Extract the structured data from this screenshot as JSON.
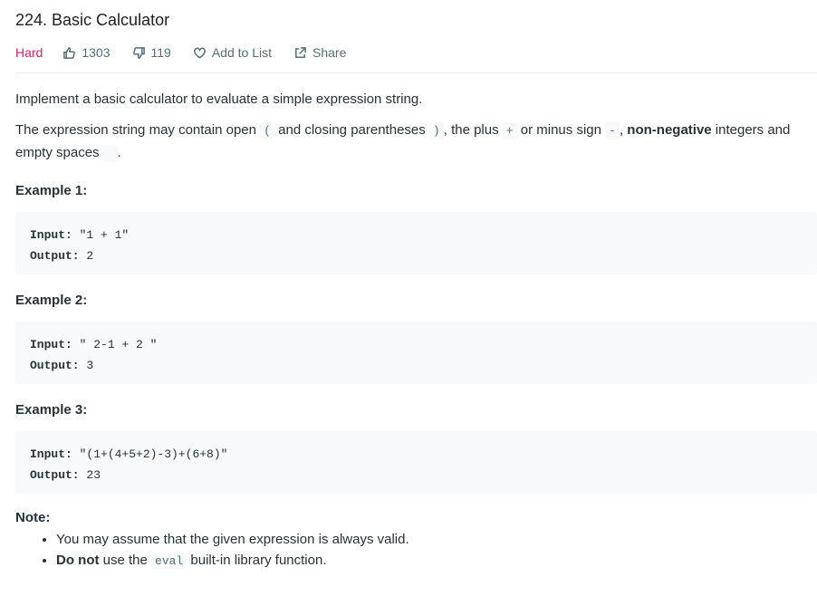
{
  "problem": {
    "title": "224. Basic Calculator",
    "difficulty": "Hard",
    "likes": "1303",
    "dislikes": "119",
    "add_to_list": "Add to List",
    "share": "Share"
  },
  "description": {
    "intro": "Implement a basic calculator to evaluate a simple expression string.",
    "p2_part1": "The expression string may contain open ",
    "p2_open_paren": "(",
    "p2_part2": " and closing parentheses ",
    "p2_close_paren": ")",
    "p2_part3": ", the plus ",
    "p2_plus": "+",
    "p2_part4": " or minus sign ",
    "p2_minus": "-",
    "p2_part5": ", ",
    "p2_nonneg": "non-negative",
    "p2_part6": " integers and empty spaces ",
    "p2_space": " ",
    "p2_part7": "."
  },
  "examples": [
    {
      "title": "Example 1:",
      "input_label": "Input:",
      "input": "\"1 + 1\"",
      "output_label": "Output:",
      "output": "2"
    },
    {
      "title": "Example 2:",
      "input_label": "Input:",
      "input": "\" 2-1 + 2 \"",
      "output_label": "Output:",
      "output": "3"
    },
    {
      "title": "Example 3:",
      "input_label": "Input:",
      "input": "\"(1+(4+5+2)-3)+(6+8)\"",
      "output_label": "Output:",
      "output": "23"
    }
  ],
  "note": {
    "title": "Note:",
    "item1": "You may assume that the given expression is always valid.",
    "item2_bold": "Do not",
    "item2_part1": " use the ",
    "item2_code": "eval",
    "item2_part2": " built-in library function."
  }
}
